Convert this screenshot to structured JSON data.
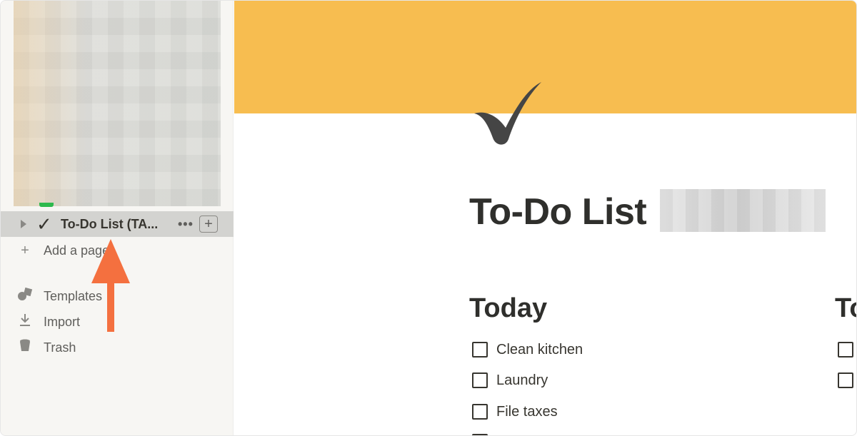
{
  "sidebar": {
    "active_page": {
      "label": "To-Do List (TA...",
      "icon": "checkmark-icon",
      "more_label": "•••",
      "add_label": "+"
    },
    "add_page_label": "Add a page",
    "items": [
      {
        "label": "Templates",
        "icon": "shapes-icon"
      },
      {
        "label": "Import",
        "icon": "download-icon"
      },
      {
        "label": "Trash",
        "icon": "trash-icon"
      }
    ]
  },
  "page": {
    "title": "To-Do List",
    "banner_color": "#f7bd50",
    "sections": [
      {
        "heading": "Today",
        "items": [
          "Clean kitchen",
          "Laundry",
          "File taxes"
        ]
      },
      {
        "heading": "To"
      }
    ]
  },
  "annotation": {
    "arrow_color": "#f4703f"
  }
}
